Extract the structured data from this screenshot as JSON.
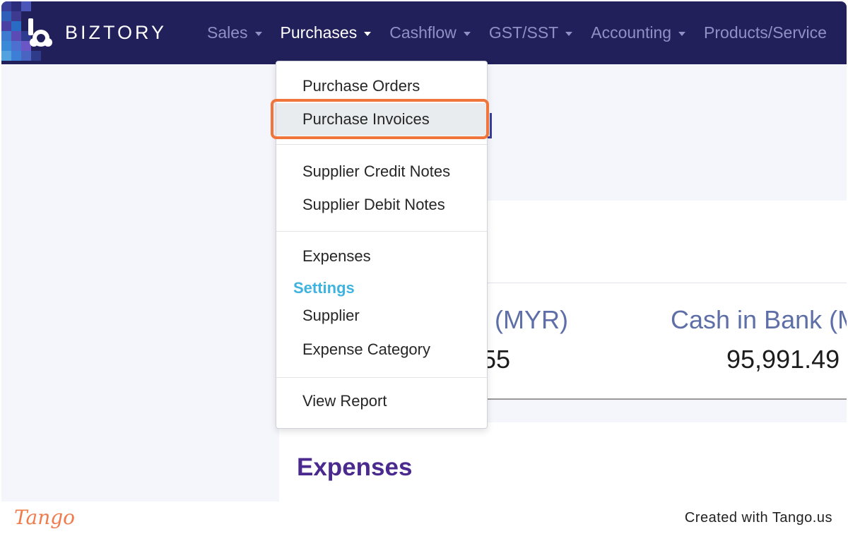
{
  "brand": {
    "name": "BIZTORY"
  },
  "nav": {
    "items": [
      {
        "label": "Sales",
        "active": false
      },
      {
        "label": "Purchases",
        "active": true
      },
      {
        "label": "Cashflow",
        "active": false
      },
      {
        "label": "GST/SST",
        "active": false
      },
      {
        "label": "Accounting",
        "active": false
      },
      {
        "label": "Products/Service",
        "active": false
      }
    ]
  },
  "purchases_menu": {
    "items": [
      "Purchase Orders",
      "Purchase Invoices",
      "Supplier Credit Notes",
      "Supplier Debit Notes",
      "Expenses",
      "Supplier",
      "Expense Category",
      "View Report"
    ],
    "section_label": "Settings",
    "highlighted_item": "Purchase Invoices"
  },
  "dashboard": {
    "stat_left_label_fragment": "l (MYR)",
    "stat_left_value_fragment": "55",
    "stat_right_label": "Cash in Bank (M",
    "stat_right_value": "95,991.49",
    "expenses_title": "Expenses"
  },
  "footer": {
    "tango_logo": "Tango",
    "created_text": "Created with Tango.us"
  },
  "colors": {
    "nav_bg": "#22205a",
    "nav_inactive": "#8f91c4",
    "highlight_border": "#f0753a",
    "settings_label": "#3fb3e0",
    "expenses_title": "#4b2a8f"
  }
}
